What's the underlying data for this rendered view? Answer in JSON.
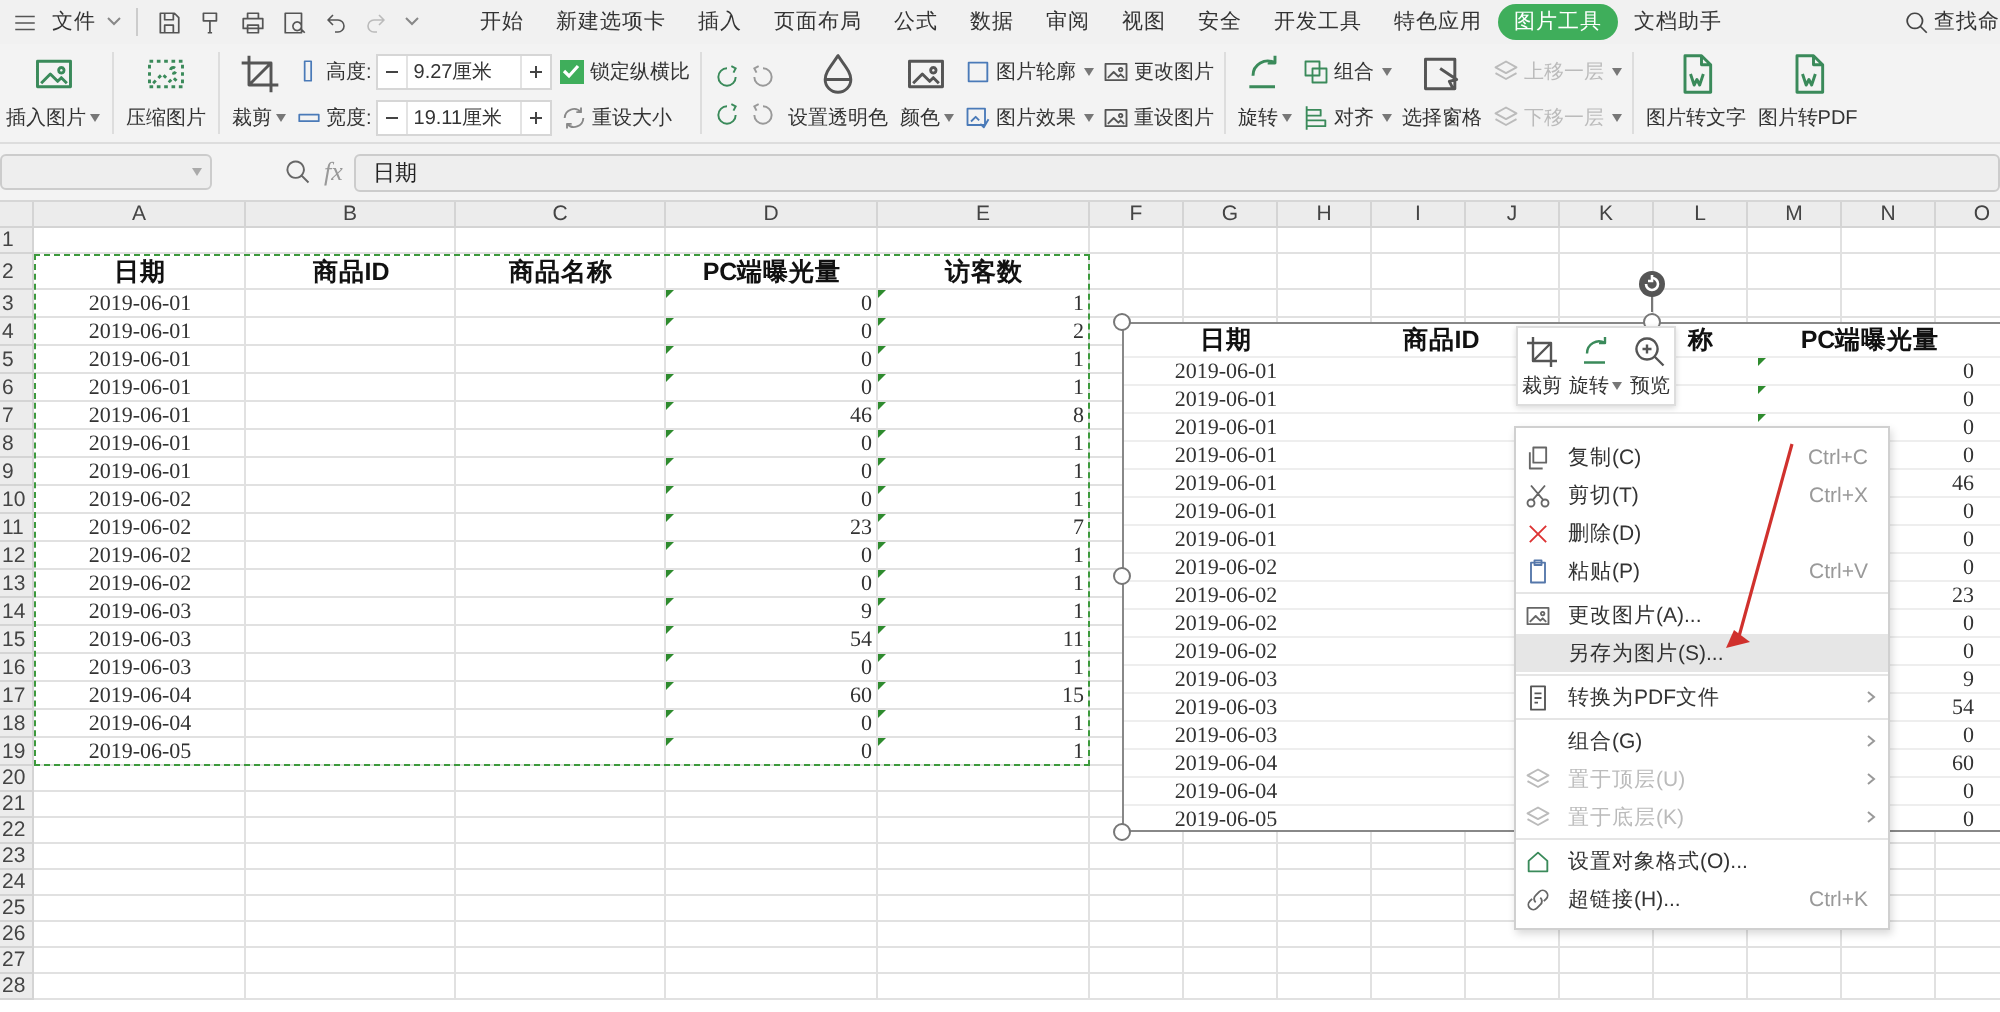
{
  "menu_bar": {
    "file_menu": "文件",
    "tabs": [
      {
        "label": "开始",
        "selected": false
      },
      {
        "label": "新建选项卡",
        "selected": false
      },
      {
        "label": "插入",
        "selected": false
      },
      {
        "label": "页面布局",
        "selected": false
      },
      {
        "label": "公式",
        "selected": false
      },
      {
        "label": "数据",
        "selected": false
      },
      {
        "label": "审阅",
        "selected": false
      },
      {
        "label": "视图",
        "selected": false
      },
      {
        "label": "安全",
        "selected": false
      },
      {
        "label": "开发工具",
        "selected": false
      },
      {
        "label": "特色应用",
        "selected": false
      },
      {
        "label": "图片工具",
        "selected": true
      },
      {
        "label": "文档助手",
        "selected": false
      }
    ],
    "search": "查找命"
  },
  "ribbon": [
    [
      {
        "kind": "large",
        "label": "插入图片",
        "dropdown": true
      }
    ],
    [
      {
        "kind": "large",
        "label": "压缩图片",
        "dropdown": false
      }
    ],
    [
      {
        "kind": "large",
        "label": "裁剪",
        "dropdown": true
      },
      {
        "kind": "stack",
        "items": [
          {
            "kind": "spinner",
            "label": "高度:",
            "value": "9.27厘米"
          },
          {
            "kind": "spinner",
            "label": "宽度:",
            "value": "19.11厘米"
          }
        ]
      },
      {
        "kind": "stack",
        "items": [
          {
            "kind": "checkbox",
            "label": "锁定纵横比",
            "checked": true
          },
          {
            "kind": "small",
            "label": "重设大小",
            "dropdown": false,
            "disabled": false
          }
        ]
      }
    ],
    [
      {
        "kind": "icon_grid"
      },
      {
        "kind": "large",
        "label": "设置透明色",
        "dropdown": false
      },
      {
        "kind": "large",
        "label": "颜色",
        "dropdown": true
      },
      {
        "kind": "stack",
        "items": [
          {
            "kind": "small",
            "label": "图片轮廓",
            "dropdown": true,
            "disabled": false
          },
          {
            "kind": "small",
            "label": "图片效果",
            "dropdown": true,
            "disabled": false
          }
        ]
      },
      {
        "kind": "stack",
        "items": [
          {
            "kind": "small",
            "label": "更改图片",
            "dropdown": false,
            "disabled": false
          },
          {
            "kind": "small",
            "label": "重设图片",
            "dropdown": false,
            "disabled": false
          }
        ]
      }
    ],
    [
      {
        "kind": "large",
        "label": "旋转",
        "dropdown": true
      },
      {
        "kind": "stack",
        "items": [
          {
            "kind": "small",
            "label": "组合",
            "dropdown": true,
            "disabled": false
          },
          {
            "kind": "small",
            "label": "对齐",
            "dropdown": true,
            "disabled": false
          }
        ]
      },
      {
        "kind": "large",
        "label": "选择窗格",
        "dropdown": false
      },
      {
        "kind": "stack",
        "items": [
          {
            "kind": "small",
            "label": "上移一层",
            "dropdown": true,
            "disabled": true
          },
          {
            "kind": "small",
            "label": "下移一层",
            "dropdown": true,
            "disabled": true
          }
        ]
      }
    ],
    [
      {
        "kind": "large",
        "label": "图片转文字",
        "dropdown": false
      },
      {
        "kind": "large",
        "label": "图片转PDF",
        "dropdown": false
      }
    ]
  ],
  "formula_bar": {
    "function_label": "fx",
    "value": "日期"
  },
  "sheet": {
    "columns": [
      "A",
      "B",
      "C",
      "D",
      "E",
      "F",
      "G",
      "H",
      "I",
      "J",
      "K",
      "L",
      "M",
      "N",
      "O"
    ],
    "copied": true,
    "rows": [
      {
        "number": "1",
        "kind": "empty"
      },
      {
        "number": "2",
        "kind": "header",
        "cells": [
          "日期",
          "商品ID",
          "商品名称",
          "PC端曝光量",
          "访客数"
        ]
      },
      {
        "number": "3",
        "kind": "data",
        "date": "2019-06-01",
        "pc_exposure": "0",
        "visitors": "1"
      },
      {
        "number": "4",
        "kind": "data",
        "date": "2019-06-01",
        "pc_exposure": "0",
        "visitors": "2"
      },
      {
        "number": "5",
        "kind": "data",
        "date": "2019-06-01",
        "pc_exposure": "0",
        "visitors": "1"
      },
      {
        "number": "6",
        "kind": "data",
        "date": "2019-06-01",
        "pc_exposure": "0",
        "visitors": "1"
      },
      {
        "number": "7",
        "kind": "data",
        "date": "2019-06-01",
        "pc_exposure": "46",
        "visitors": "8"
      },
      {
        "number": "8",
        "kind": "data",
        "date": "2019-06-01",
        "pc_exposure": "0",
        "visitors": "1"
      },
      {
        "number": "9",
        "kind": "data",
        "date": "2019-06-01",
        "pc_exposure": "0",
        "visitors": "1"
      },
      {
        "number": "10",
        "kind": "data",
        "date": "2019-06-02",
        "pc_exposure": "0",
        "visitors": "1"
      },
      {
        "number": "11",
        "kind": "data",
        "date": "2019-06-02",
        "pc_exposure": "23",
        "visitors": "7"
      },
      {
        "number": "12",
        "kind": "data",
        "date": "2019-06-02",
        "pc_exposure": "0",
        "visitors": "1"
      },
      {
        "number": "13",
        "kind": "data",
        "date": "2019-06-02",
        "pc_exposure": "0",
        "visitors": "1"
      },
      {
        "number": "14",
        "kind": "data",
        "date": "2019-06-03",
        "pc_exposure": "9",
        "visitors": "1"
      },
      {
        "number": "15",
        "kind": "data",
        "date": "2019-06-03",
        "pc_exposure": "54",
        "visitors": "11"
      },
      {
        "number": "16",
        "kind": "data",
        "date": "2019-06-03",
        "pc_exposure": "0",
        "visitors": "1"
      },
      {
        "number": "17",
        "kind": "data",
        "date": "2019-06-04",
        "pc_exposure": "60",
        "visitors": "15"
      },
      {
        "number": "18",
        "kind": "data",
        "date": "2019-06-04",
        "pc_exposure": "0",
        "visitors": "1"
      },
      {
        "number": "19",
        "kind": "data",
        "date": "2019-06-05",
        "pc_exposure": "0",
        "visitors": "1"
      },
      {
        "number": "20",
        "kind": "empty"
      },
      {
        "number": "21",
        "kind": "empty"
      },
      {
        "number": "22",
        "kind": "empty"
      },
      {
        "number": "23",
        "kind": "empty"
      },
      {
        "number": "24",
        "kind": "empty"
      },
      {
        "number": "25",
        "kind": "empty"
      },
      {
        "number": "26",
        "kind": "empty"
      },
      {
        "number": "27",
        "kind": "empty"
      },
      {
        "number": "28",
        "kind": "empty"
      }
    ]
  },
  "picture": {
    "headers": [
      "日期",
      "商品ID",
      "称",
      "PC端曝光量"
    ],
    "rows": [
      {
        "date": "2019-06-01",
        "pc_exposure": "0"
      },
      {
        "date": "2019-06-01",
        "pc_exposure": "0"
      },
      {
        "date": "2019-06-01",
        "pc_exposure": "0"
      },
      {
        "date": "2019-06-01",
        "pc_exposure": "0"
      },
      {
        "date": "2019-06-01",
        "pc_exposure": "46"
      },
      {
        "date": "2019-06-01",
        "pc_exposure": "0"
      },
      {
        "date": "2019-06-01",
        "pc_exposure": "0"
      },
      {
        "date": "2019-06-02",
        "pc_exposure": "0"
      },
      {
        "date": "2019-06-02",
        "pc_exposure": "23"
      },
      {
        "date": "2019-06-02",
        "pc_exposure": "0"
      },
      {
        "date": "2019-06-02",
        "pc_exposure": "0"
      },
      {
        "date": "2019-06-03",
        "pc_exposure": "9"
      },
      {
        "date": "2019-06-03",
        "pc_exposure": "54"
      },
      {
        "date": "2019-06-03",
        "pc_exposure": "0"
      },
      {
        "date": "2019-06-04",
        "pc_exposure": "60"
      },
      {
        "date": "2019-06-04",
        "pc_exposure": "0"
      },
      {
        "date": "2019-06-05",
        "pc_exposure": "0"
      }
    ]
  },
  "mini_toolbar": [
    {
      "label": "裁剪",
      "dropdown": false
    },
    {
      "label": "旋转",
      "dropdown": true
    },
    {
      "label": "预览",
      "dropdown": false
    }
  ],
  "context_menu": [
    [
      {
        "label": "复制(C)",
        "shortcut": "Ctrl+C",
        "submenu": false,
        "disabled": false,
        "selected": false
      },
      {
        "label": "剪切(T)",
        "shortcut": "Ctrl+X",
        "submenu": false,
        "disabled": false,
        "selected": false
      },
      {
        "label": "删除(D)",
        "submenu": false,
        "disabled": false,
        "selected": false
      },
      {
        "label": "粘贴(P)",
        "shortcut": "Ctrl+V",
        "submenu": false,
        "disabled": false,
        "selected": false
      }
    ],
    [
      {
        "label": "更改图片(A)...",
        "submenu": false,
        "disabled": false,
        "selected": false
      },
      {
        "label": "另存为图片(S)...",
        "submenu": false,
        "disabled": false,
        "selected": true
      }
    ],
    [
      {
        "label": "转换为PDF文件",
        "submenu": true,
        "disabled": false,
        "selected": false
      }
    ],
    [
      {
        "label": "组合(G)",
        "submenu": true,
        "disabled": false,
        "selected": false
      },
      {
        "label": "置于顶层(U)",
        "submenu": true,
        "disabled": true,
        "selected": false
      },
      {
        "label": "置于底层(K)",
        "submenu": true,
        "disabled": true,
        "selected": false
      }
    ],
    [
      {
        "label": "设置对象格式(O)...",
        "submenu": false,
        "disabled": false,
        "selected": false
      },
      {
        "label": "超链接(H)...",
        "shortcut": "Ctrl+K",
        "submenu": false,
        "disabled": false,
        "selected": false
      }
    ]
  ]
}
